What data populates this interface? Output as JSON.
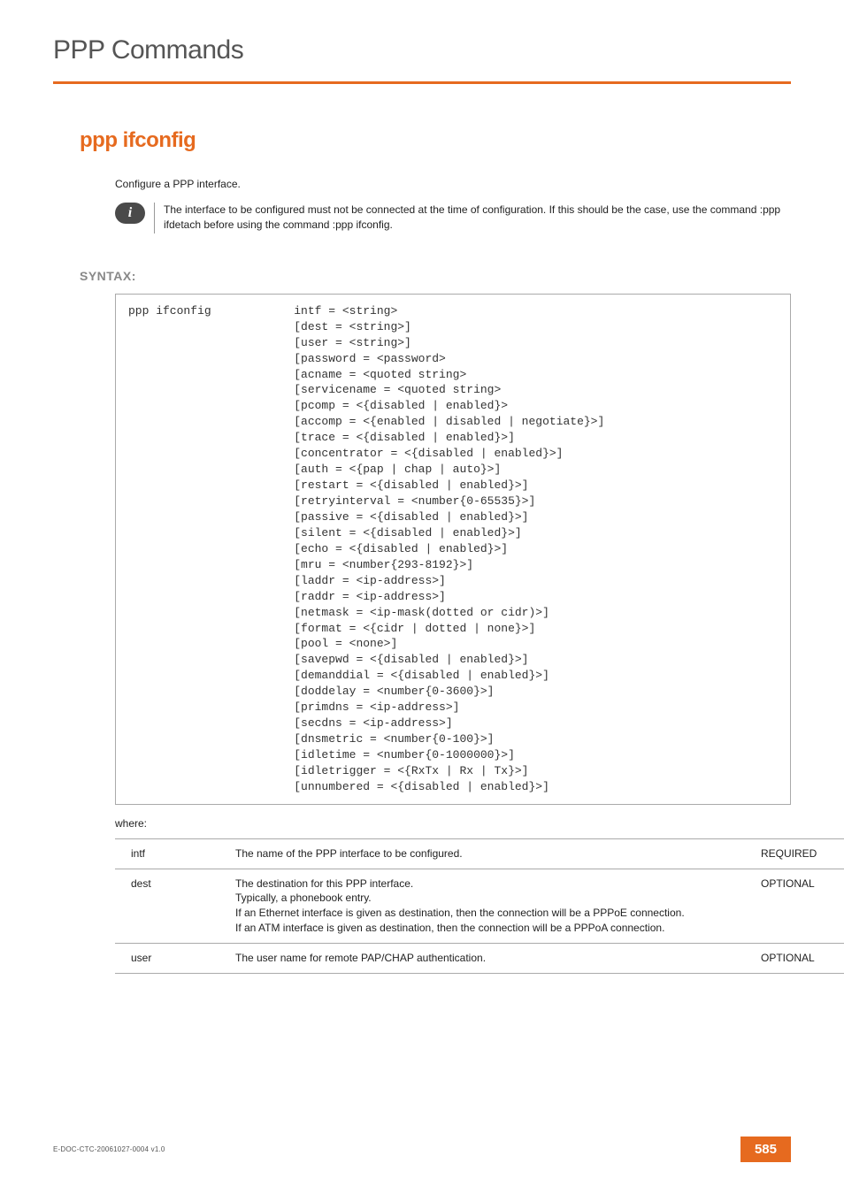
{
  "chapter": "PPP Commands",
  "command_title": "ppp ifconfig",
  "intro": "Configure a PPP interface.",
  "note": "The interface to be configured must not be connected at the time of configuration. If this should be the case, use the command :ppp ifdetach before using the command :ppp ifconfig.",
  "section_label": "SYNTAX:",
  "syntax_cmd": "ppp ifconfig",
  "syntax_lines": [
    "intf = <string>",
    "[dest = <string>]",
    "[user = <string>]",
    "[password = <password>",
    "[acname = <quoted string>",
    "[servicename = <quoted string>",
    "[pcomp = <{disabled | enabled}>",
    "[accomp = <{enabled | disabled | negotiate}>]",
    "[trace = <{disabled | enabled}>]",
    "[concentrator = <{disabled | enabled}>]",
    "[auth = <{pap | chap | auto}>]",
    "[restart = <{disabled | enabled}>]",
    "[retryinterval = <number{0-65535}>]",
    "[passive = <{disabled | enabled}>]",
    "[silent = <{disabled | enabled}>]",
    "[echo = <{disabled | enabled}>]",
    "[mru = <number{293-8192}>]",
    "[laddr = <ip-address>]",
    "[raddr = <ip-address>]",
    "[netmask = <ip-mask(dotted or cidr)>]",
    "[format = <{cidr | dotted | none}>]",
    "[pool = <none>]",
    "[savepwd = <{disabled | enabled}>]",
    "[demanddial = <{disabled | enabled}>]",
    "[doddelay = <number{0-3600}>]",
    "[primdns = <ip-address>]",
    "[secdns = <ip-address>]",
    "[dnsmetric = <number{0-100}>]",
    "[idletime = <number{0-1000000}>]",
    "[idletrigger = <{RxTx | Rx | Tx}>]",
    "[unnumbered = <{disabled | enabled}>]"
  ],
  "where_label": "where:",
  "params": [
    {
      "name": "intf",
      "desc": "The name of the PPP interface to be configured.",
      "req": "REQUIRED"
    },
    {
      "name": "dest",
      "desc": "The destination for this PPP interface.\nTypically, a phonebook entry.\nIf an Ethernet interface is given as destination, then the connection will be a PPPoE connection.\nIf an ATM interface is given as destination, then the connection will be a PPPoA connection.",
      "req": "OPTIONAL"
    },
    {
      "name": "user",
      "desc": "The user name for remote PAP/CHAP authentication.",
      "req": "OPTIONAL"
    }
  ],
  "footer_doc": "E-DOC-CTC-20061027-0004 v1.0",
  "page_number": "585"
}
